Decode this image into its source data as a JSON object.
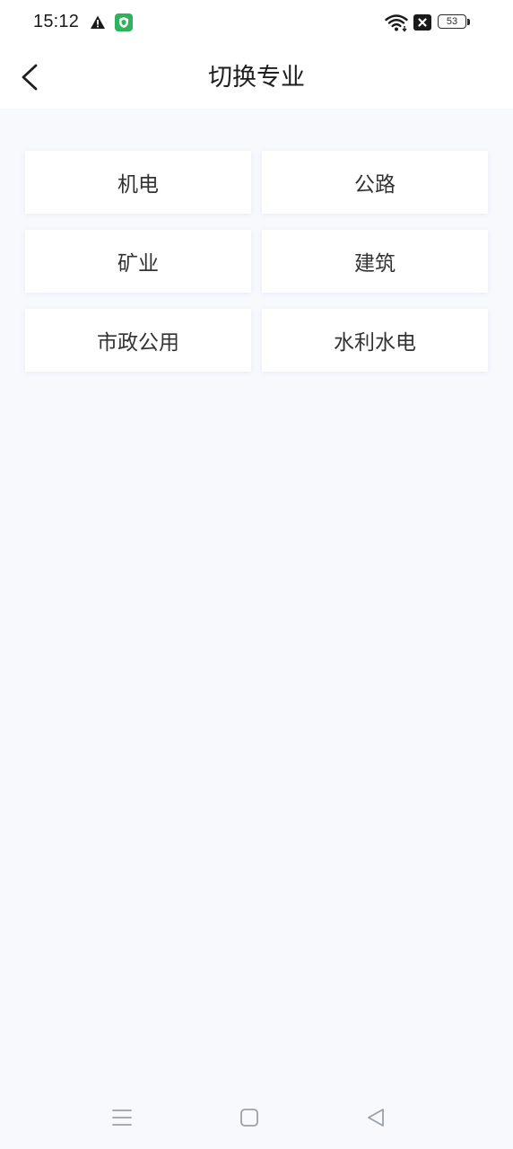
{
  "status_bar": {
    "time": "15:12",
    "battery_level": "53",
    "icons": [
      "warning-icon",
      "shield-icon",
      "wifi-icon",
      "x-icon",
      "battery-icon"
    ]
  },
  "header": {
    "title": "切换专业",
    "back_icon": "chevron-left-icon"
  },
  "majors": [
    {
      "label": "机电"
    },
    {
      "label": "公路"
    },
    {
      "label": "矿业"
    },
    {
      "label": "建筑"
    },
    {
      "label": "市政公用"
    },
    {
      "label": "水利水电"
    }
  ],
  "nav_bar": {
    "icons": [
      "menu-icon",
      "home-icon",
      "back-triangle-icon"
    ]
  },
  "colors": {
    "background": "#f7f9fd",
    "card": "#ffffff",
    "text": "#333333",
    "shield_green": "#2fb35a"
  }
}
